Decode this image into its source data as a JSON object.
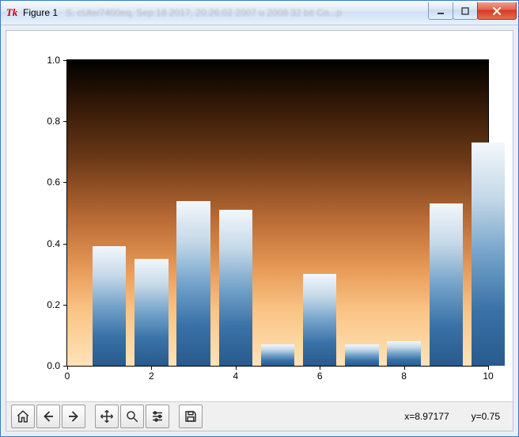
{
  "window": {
    "title": "Figure 1",
    "bg_blur_text": "S. cUte/7400eq,  Sep 18 2017,  20:26:02  2007  u 2008  32 bit  Co...p"
  },
  "chart_data": {
    "type": "bar",
    "categories": [
      1,
      2,
      3,
      4,
      5,
      6,
      7,
      8,
      9,
      10
    ],
    "values": [
      0.39,
      0.35,
      0.54,
      0.51,
      0.07,
      0.3,
      0.07,
      0.08,
      0.53,
      0.73
    ],
    "xlim": [
      0,
      10
    ],
    "ylim": [
      0.0,
      1.0
    ],
    "xticks": [
      0,
      2,
      4,
      6,
      8,
      10
    ],
    "yticks": [
      0.0,
      0.2,
      0.4,
      0.6,
      0.8,
      1.0
    ],
    "bar_width": 0.8,
    "bar_align": "center"
  },
  "toolbar": {
    "items": [
      {
        "name": "home-button",
        "icon": "home"
      },
      {
        "name": "back-button",
        "icon": "arrow-left"
      },
      {
        "name": "forward-button",
        "icon": "arrow-right"
      },
      {
        "sep": true
      },
      {
        "name": "pan-button",
        "icon": "move"
      },
      {
        "name": "zoom-button",
        "icon": "zoom"
      },
      {
        "name": "configure-subplots-button",
        "icon": "sliders"
      },
      {
        "sep": true
      },
      {
        "name": "save-button",
        "icon": "save"
      }
    ]
  },
  "status": {
    "x_label": "x=8.97177",
    "y_label": "y=0.75"
  }
}
